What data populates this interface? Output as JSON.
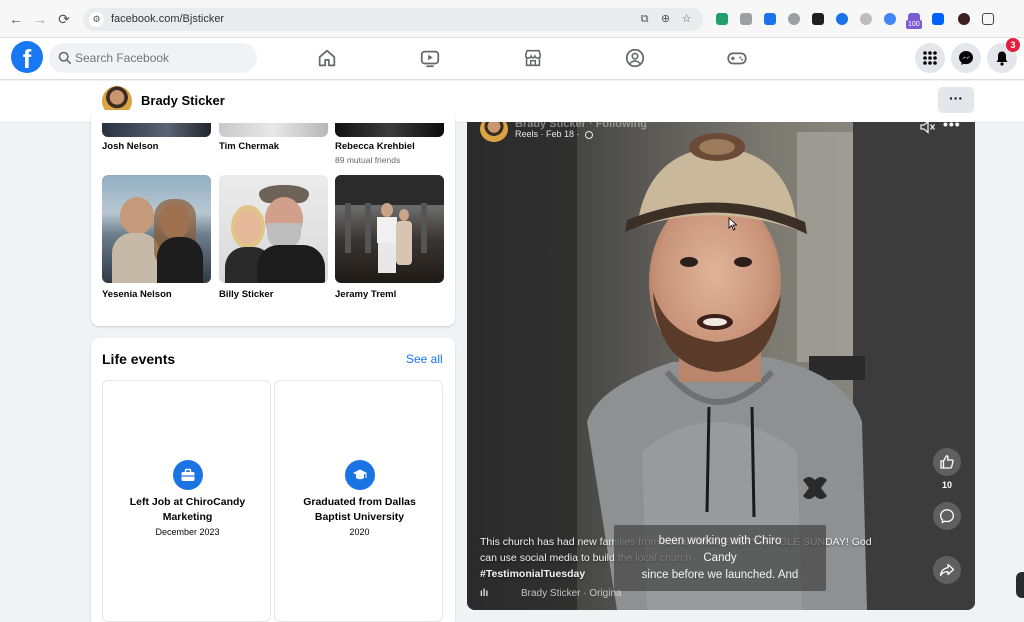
{
  "browser": {
    "url": "facebook.com/Bjsticker",
    "nav": {
      "back": "←",
      "forward": "→",
      "reload": "⟳"
    },
    "extension_badge": "100",
    "extension_colors": [
      "#22a06b",
      "#9aa0a6",
      "#1a73e8",
      "#9aa0a6",
      "#1f1f1f",
      "#1a73e8",
      "#bdbdbd",
      "#4285f4",
      "#7c5cd6",
      "#0061fe",
      "#3c1f1f",
      "#444444"
    ]
  },
  "facebook": {
    "brand_color": "#1877f2",
    "logo_letter": "f",
    "search": {
      "placeholder": "Search Facebook"
    },
    "nav_icons": [
      "home-icon",
      "video-icon",
      "marketplace-icon",
      "groups-icon",
      "gaming-icon"
    ],
    "notifications_count": "3"
  },
  "profile_bar": {
    "name": "Brady Sticker",
    "more_label": "···"
  },
  "friends": {
    "top_row": [
      {
        "name": "Josh Nelson",
        "mutual": ""
      },
      {
        "name": "Tim Chermak",
        "mutual": ""
      },
      {
        "name": "Rebecca Krehbiel",
        "mutual": "89 mutual friends"
      }
    ],
    "bottom_row": [
      {
        "name": "Yesenia Nelson"
      },
      {
        "name": "Billy Sticker"
      },
      {
        "name": "Jeramy Treml"
      }
    ]
  },
  "life_events": {
    "title": "Life events",
    "see_all": "See all",
    "events": [
      {
        "title_line1": "Left Job at ChiroCandy",
        "title_line2": "Marketing",
        "date": "December 2023",
        "icon": "briefcase-icon"
      },
      {
        "title_line1": "Graduated from Dallas",
        "title_line2": "Baptist University",
        "date": "2020",
        "icon": "graduation-cap-icon"
      }
    ]
  },
  "reel": {
    "author": "Brady Sticker · Following",
    "meta": "Reels · Feb 18 ·",
    "like_count": "10",
    "caption_line1": "This church has had new families from social media EVERY SINGLE SUNDAY! God",
    "caption_line2": "can use social media to build the local church",
    "caption_line3": "#TestimonialTuesday",
    "subtitle_line1": "been working with Chiro",
    "subtitle_line2": "Candy",
    "subtitle_line3": "since before we launched. And",
    "audio": "Brady Sticker · Origina"
  }
}
